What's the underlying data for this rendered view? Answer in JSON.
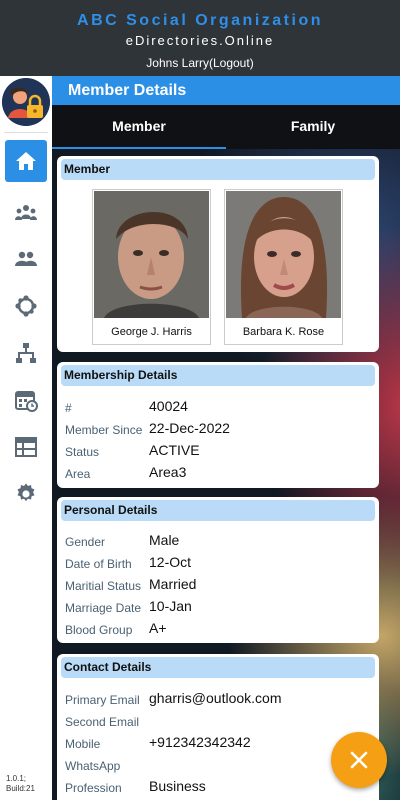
{
  "header": {
    "org_name": "ABC Social Organization",
    "org_site": "eDirectories.Online",
    "user_line": "Johns Larry(Logout)"
  },
  "sidebar": {
    "items": [
      {
        "icon": "home-icon",
        "active": true
      },
      {
        "icon": "community-icon",
        "active": false
      },
      {
        "icon": "groups-icon",
        "active": false
      },
      {
        "icon": "network-circle-icon",
        "active": false
      },
      {
        "icon": "hierarchy-icon",
        "active": false
      },
      {
        "icon": "calendar-event-icon",
        "active": false
      },
      {
        "icon": "table-icon",
        "active": false
      },
      {
        "icon": "gear-icon",
        "active": false
      }
    ],
    "version_line1": "1.0.1;",
    "version_line2": "Build:21"
  },
  "page": {
    "title": "Member Details",
    "tabs": [
      {
        "label": "Member",
        "active": true
      },
      {
        "label": "Family",
        "active": false
      }
    ]
  },
  "member_card": {
    "heading": "Member",
    "photos": [
      {
        "caption": "George J. Harris"
      },
      {
        "caption": "Barbara K. Rose"
      }
    ]
  },
  "membership": {
    "heading": "Membership Details",
    "rows": [
      {
        "label": "#",
        "value": "40024"
      },
      {
        "label": "Member Since",
        "value": "22-Dec-2022"
      },
      {
        "label": "Status",
        "value": "ACTIVE"
      },
      {
        "label": "Area",
        "value": "Area3"
      }
    ]
  },
  "personal": {
    "heading": "Personal Details",
    "rows": [
      {
        "label": "Gender",
        "value": "Male"
      },
      {
        "label": "Date of Birth",
        "value": "12-Oct"
      },
      {
        "label": "Maritial Status",
        "value": "Married"
      },
      {
        "label": "Marriage Date",
        "value": "10-Jan"
      },
      {
        "label": "Blood Group",
        "value": "A+"
      }
    ]
  },
  "contact": {
    "heading": "Contact Details",
    "rows": [
      {
        "label": "Primary Email",
        "value": "gharris@outlook.com"
      },
      {
        "label": "Second Email",
        "value": ""
      },
      {
        "label": "Mobile",
        "value": "+912342342342"
      },
      {
        "label": "WhatsApp",
        "value": ""
      },
      {
        "label": "Profession",
        "value": "Business"
      }
    ]
  },
  "colors": {
    "accent": "#2b8fe6",
    "org_name": "#2f8fe8",
    "section_header": "#b9dbf7",
    "fab": "#f59f14"
  },
  "fab": {
    "icon": "close-icon"
  }
}
